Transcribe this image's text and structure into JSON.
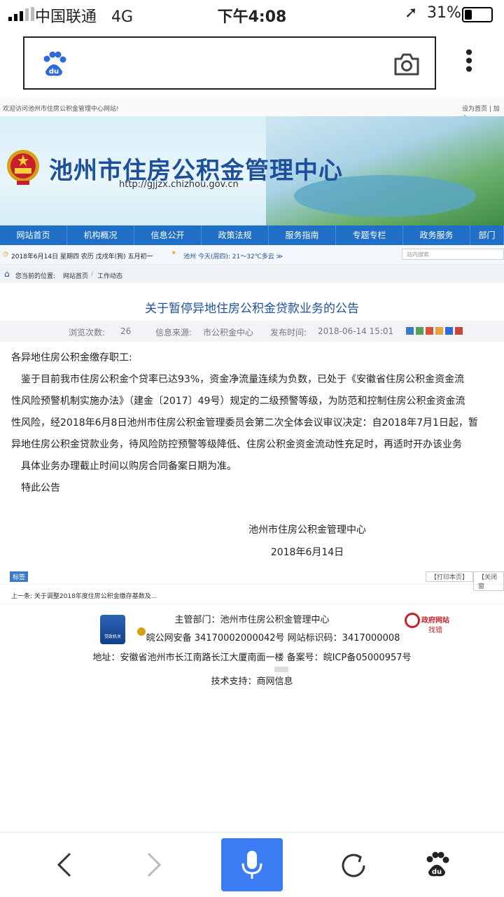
{
  "status": {
    "carrier": "中国联通",
    "network": "4G",
    "time": "下午4:08",
    "battery": "31%"
  },
  "page": {
    "welcome": "欢迎访问池州市住房公积金管理中心网站!",
    "toplinks": "设为首页 | 加入",
    "site_title": "池州市住房公积金管理中心",
    "site_url": "http://gjjzx.chizhou.gov.cn",
    "nav": [
      "网站首页",
      "机构概况",
      "信息公开",
      "政策法规",
      "服务指南",
      "专题专栏",
      "政务服务",
      "部门"
    ],
    "date_text": "2018年6月14日 星期四 农历 戊戌年(狗) 五月初一",
    "weather": "池州  今天(周四): 21～32℃多云 ≫",
    "search_placeholder": "站内搜索",
    "breadcrumb": {
      "label": "您当前的位置:",
      "home": "网站首页",
      "current": "工作动态"
    },
    "article": {
      "title": "关于暂停异地住房公积金贷款业务的公告",
      "views_label": "浏览次数:",
      "views": "26",
      "source_label": "信息来源:",
      "source": "市公积金中心",
      "time_label": "发布时间:",
      "time": "2018-06-14 15:01",
      "lines": [
        "各异地住房公积金缴存职工:",
        "　鉴于目前我市住房公积金个贷率已达93%，资金净流量连续为负数，已处于《安徽省住房公积金资金流",
        "性风险预警机制实施办法》（建金〔2017〕49号）规定的二级预警等级，为防范和控制住房公积金资金流",
        "性风险，经2018年6月8日池州市住房公积金管理委员会第二次全体会议审议决定：自2018年7月1日起，暂",
        "异地住房公积金贷款业务，待风险防控预警等级降低、住房公积金资金流动性充足时，再适时开办该业务",
        "　具体业务办理截止时间以购房合同备案日期为准。",
        "　特此公告"
      ],
      "signer": "池州市住房公积金管理中心",
      "date": "2018年6月14日"
    },
    "tag_label": "标签",
    "print_label": "【打印本页】",
    "close_label": "【关闭窗",
    "prev": "上一条: 关于调整2018年度住房公积金缴存基数及...",
    "footer": {
      "dept": "主管部门：池州市住房公积金管理中心",
      "record": "皖公网安备 34170002000042号  网站标识码：3417000008",
      "address": "地址：安徽省池州市长江南路长江大厦南面一楼  备案号：皖ICP备05000957号",
      "support": "技术支持：商网信息",
      "gov_badge_top": "政府网站",
      "gov_badge_bottom": "找错",
      "party_badge": "党政机关"
    }
  },
  "colors": {
    "nav_blue": "#1f6fc7",
    "title_blue": "#1d4f9a",
    "mic_blue": "#3b7cf5"
  }
}
